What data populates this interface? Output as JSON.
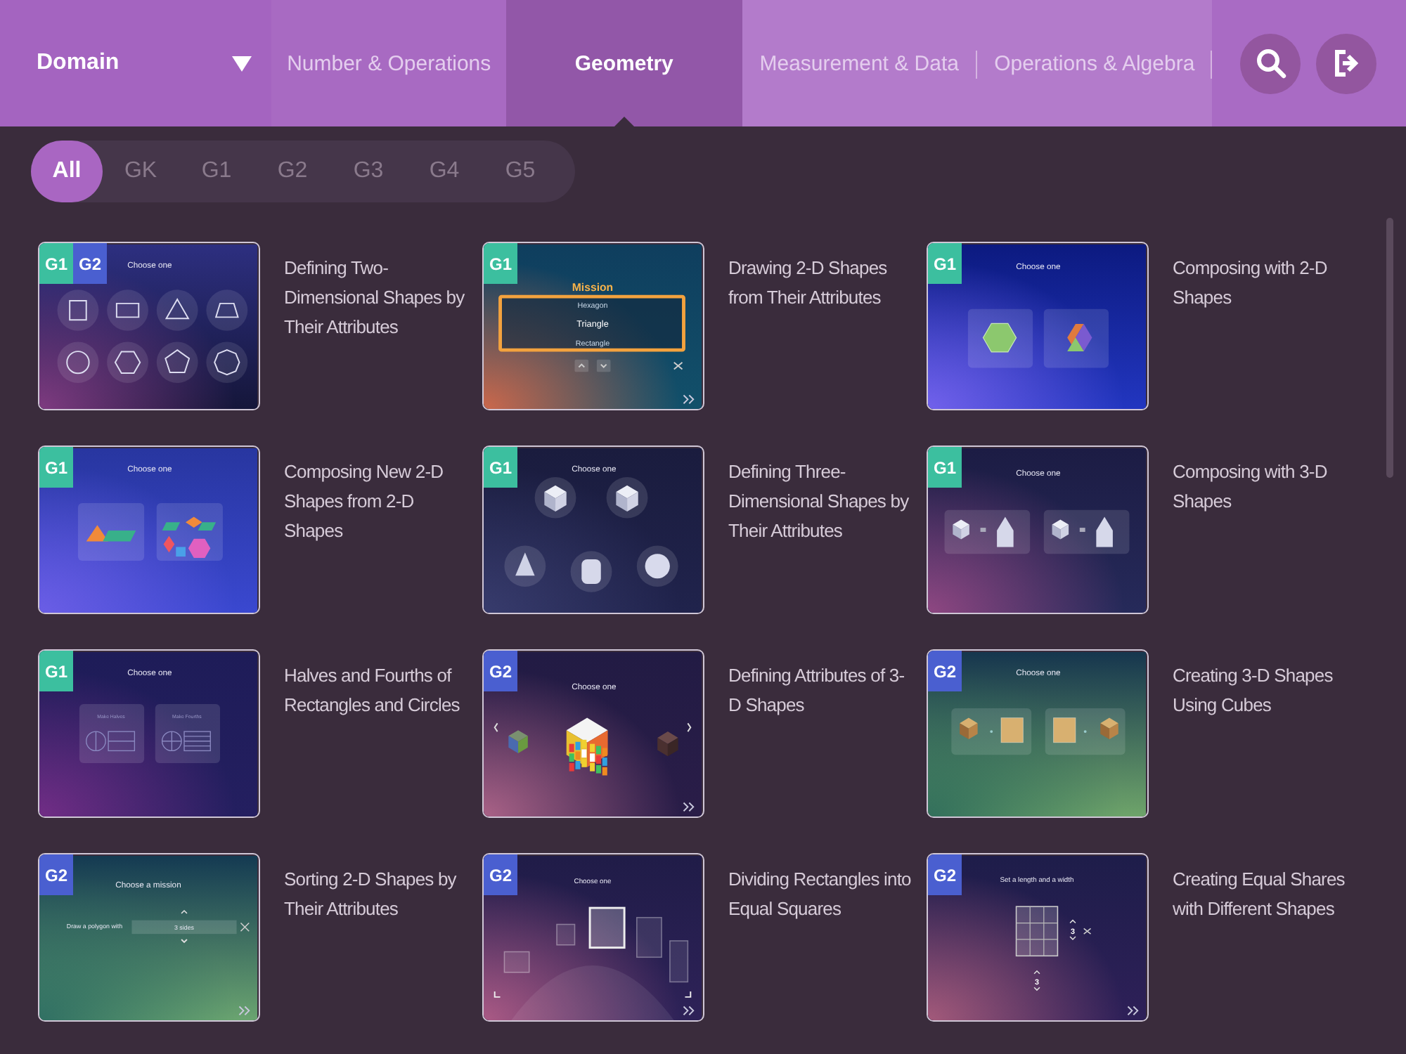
{
  "header": {
    "domain": {
      "label": "Domain"
    },
    "tabs": [
      {
        "label": "Number & Operations",
        "selected": false
      },
      {
        "label": "Geometry",
        "selected": true
      },
      {
        "label": "Measurement & Data",
        "selected": false
      },
      {
        "label": "Operations & Algebra",
        "selected": false
      }
    ]
  },
  "grade_filters": [
    {
      "label": "All",
      "selected": true
    },
    {
      "label": "GK",
      "selected": false
    },
    {
      "label": "G1",
      "selected": false
    },
    {
      "label": "G2",
      "selected": false
    },
    {
      "label": "G3",
      "selected": false
    },
    {
      "label": "G4",
      "selected": false
    },
    {
      "label": "G5",
      "selected": false
    }
  ],
  "lessons": [
    {
      "title": "Defining Two-Dimensional Shapes by Their Attributes",
      "badges": [
        {
          "label": "G1",
          "color": "#3cbf9f"
        },
        {
          "label": "G2",
          "color": "#4a5fd0"
        }
      ],
      "thumbnail": {
        "kind": "shapes-grid",
        "texts": [
          "Choose one"
        ]
      }
    },
    {
      "title": "Drawing 2-D Shapes from Their Attributes",
      "badges": [
        {
          "label": "G1",
          "color": "#3cbf9f"
        }
      ],
      "thumbnail": {
        "kind": "mission-list",
        "texts": [
          "Mission",
          "Hexagon",
          "Triangle",
          "Rectangle"
        ]
      }
    },
    {
      "title": "Composing with 2-D Shapes",
      "badges": [
        {
          "label": "G1",
          "color": "#3cbf9f"
        }
      ],
      "thumbnail": {
        "kind": "hexagons",
        "texts": [
          "Choose one"
        ]
      }
    },
    {
      "title": "Composing New 2-D Shapes from 2-D Shapes",
      "badges": [
        {
          "label": "G1",
          "color": "#3cbf9f"
        }
      ],
      "thumbnail": {
        "kind": "composing",
        "texts": [
          "Choose one"
        ]
      }
    },
    {
      "title": "Defining Three-Dimensional Shapes by Their Attributes",
      "badges": [
        {
          "label": "G1",
          "color": "#3cbf9f"
        }
      ],
      "thumbnail": {
        "kind": "solids",
        "texts": [
          "Choose one"
        ]
      }
    },
    {
      "title": "Composing with 3-D Shapes",
      "badges": [
        {
          "label": "G1",
          "color": "#3cbf9f"
        }
      ],
      "thumbnail": {
        "kind": "composing-3d",
        "texts": [
          "Choose one"
        ]
      }
    },
    {
      "title": "Halves and Fourths of Rectangles and Circles",
      "badges": [
        {
          "label": "G1",
          "color": "#3cbf9f"
        }
      ],
      "thumbnail": {
        "kind": "halves-fourths",
        "texts": [
          "Choose one",
          "Make Halves",
          "Make Fourths"
        ]
      }
    },
    {
      "title": "Defining Attributes of 3-D Shapes",
      "badges": [
        {
          "label": "G2",
          "color": "#4a5fd0"
        }
      ],
      "thumbnail": {
        "kind": "cube-carousel",
        "texts": [
          "Choose one"
        ]
      }
    },
    {
      "title": "Creating 3-D Shapes Using Cubes",
      "badges": [
        {
          "label": "G2",
          "color": "#4a5fd0"
        }
      ],
      "thumbnail": {
        "kind": "cube-grid",
        "texts": [
          "Choose one"
        ]
      }
    },
    {
      "title": "Sorting 2-D Shapes by Their Attributes",
      "badges": [
        {
          "label": "G2",
          "color": "#4a5fd0"
        }
      ],
      "thumbnail": {
        "kind": "polygon-mission",
        "texts": [
          "Choose a mission",
          "Draw a polygon with",
          "3 sides"
        ]
      }
    },
    {
      "title": "Dividing Rectangles into Equal Squares",
      "badges": [
        {
          "label": "G2",
          "color": "#4a5fd0"
        }
      ],
      "thumbnail": {
        "kind": "rectangle-arc",
        "texts": [
          "Choose one"
        ]
      }
    },
    {
      "title": "Creating Equal Shares with Different Shapes",
      "badges": [
        {
          "label": "G2",
          "color": "#4a5fd0"
        }
      ],
      "thumbnail": {
        "kind": "length-width",
        "texts": [
          "Set a length and a width",
          "3",
          "3"
        ]
      }
    }
  ]
}
